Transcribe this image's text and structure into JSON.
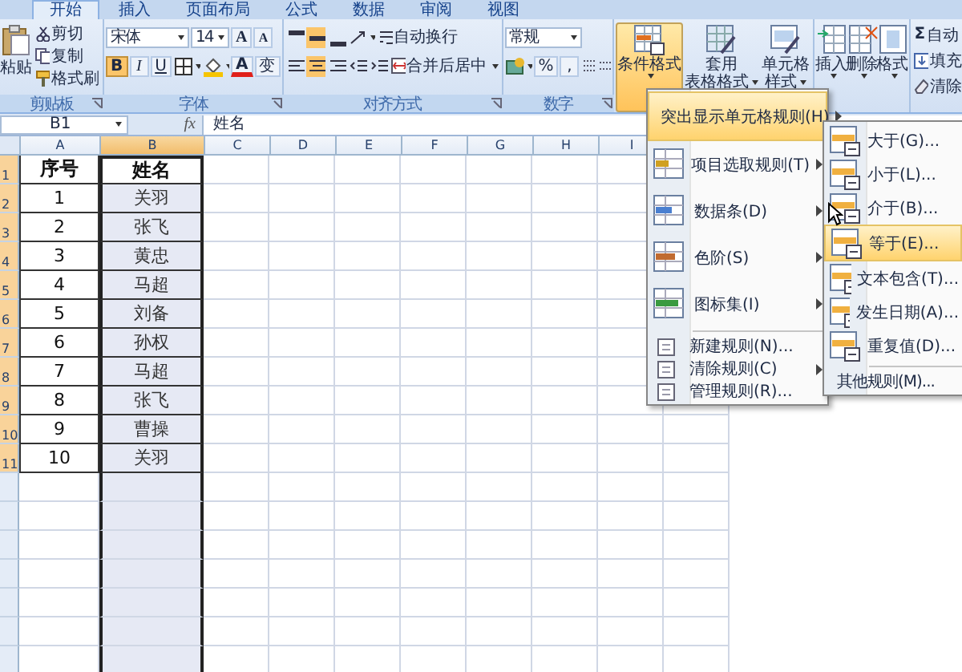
{
  "tabs": [
    {
      "label": "开始",
      "selected": true
    },
    {
      "label": "插入",
      "selected": false
    },
    {
      "label": "页面布局",
      "selected": false
    },
    {
      "label": "公式",
      "selected": false
    },
    {
      "label": "数据",
      "selected": false
    },
    {
      "label": "审阅",
      "selected": false
    },
    {
      "label": "视图",
      "selected": false
    }
  ],
  "ribbon": {
    "clipboard": {
      "label": "剪贴板",
      "paste": "粘贴",
      "cut": "剪切",
      "copy": "复制",
      "format_painter": "格式刷"
    },
    "font": {
      "label": "字体",
      "font_name": "宋体",
      "font_size": "14",
      "grow": "A",
      "shrink": "A",
      "toggles": [
        {
          "label": "B",
          "kind": "bold",
          "selected": true
        },
        {
          "label": "I",
          "kind": "italic",
          "selected": false
        },
        {
          "label": "U",
          "kind": "underline",
          "selected": false
        }
      ],
      "font_color": "A",
      "phonetic": "变"
    },
    "alignment": {
      "label": "对齐方式",
      "wrap_text": "自动换行",
      "merge": "合并后居中",
      "vertical": [
        {
          "selected": false
        },
        {
          "selected": true
        },
        {
          "selected": false
        }
      ],
      "horizontal": [
        {
          "selected": false
        },
        {
          "selected": true
        },
        {
          "selected": false
        }
      ]
    },
    "number": {
      "label": "数字",
      "format": "常规",
      "percent": "%",
      "comma": ","
    },
    "styles": {
      "conditional_format": {
        "label": "条件格式",
        "expanded": true
      },
      "table_format": [
        "套用",
        "表格格式"
      ],
      "cell_styles": [
        "单元格",
        "样式"
      ]
    },
    "cells": {
      "insert": "插入",
      "delete": "删除",
      "format": "格式"
    },
    "editing": {
      "sigma": "Σ",
      "autosum": "自动",
      "fill": "填充",
      "clear": "清除"
    }
  },
  "formula_bar": {
    "name_box": "B1",
    "function_label": "fx",
    "content": "姓名"
  },
  "columns": [
    {
      "label": "A",
      "selected": false
    },
    {
      "label": "B",
      "selected": true
    },
    {
      "label": "C",
      "selected": false
    },
    {
      "label": "D",
      "selected": false
    },
    {
      "label": "E",
      "selected": false
    },
    {
      "label": "F",
      "selected": false
    },
    {
      "label": "G",
      "selected": false
    },
    {
      "label": "H",
      "selected": false
    },
    {
      "label": "I",
      "selected": false
    }
  ],
  "rows": [
    {
      "number": "1",
      "selected": true,
      "kind": "header",
      "cells": [
        "序号",
        "姓名"
      ]
    },
    {
      "number": "2",
      "selected": true,
      "kind": "data",
      "cells": [
        "1",
        "关羽"
      ]
    },
    {
      "number": "3",
      "selected": true,
      "kind": "data",
      "cells": [
        "2",
        "张飞"
      ]
    },
    {
      "number": "4",
      "selected": true,
      "kind": "data",
      "cells": [
        "3",
        "黄忠"
      ]
    },
    {
      "number": "5",
      "selected": true,
      "kind": "data",
      "cells": [
        "4",
        "马超"
      ]
    },
    {
      "number": "6",
      "selected": true,
      "kind": "data",
      "cells": [
        "5",
        "刘备"
      ]
    },
    {
      "number": "7",
      "selected": true,
      "kind": "data",
      "cells": [
        "6",
        "孙权"
      ]
    },
    {
      "number": "8",
      "selected": true,
      "kind": "data",
      "cells": [
        "7",
        "马超"
      ]
    },
    {
      "number": "9",
      "selected": true,
      "kind": "data",
      "cells": [
        "8",
        "张飞"
      ]
    },
    {
      "number": "10",
      "selected": true,
      "kind": "data",
      "cells": [
        "9",
        "曹操"
      ]
    },
    {
      "number": "11",
      "selected": true,
      "kind": "data",
      "cells": [
        "10",
        "关羽"
      ]
    }
  ],
  "menu": {
    "items": [
      {
        "kind": "large",
        "label": "突出显示单元格规则(H)",
        "submenu": true,
        "selected": true
      },
      {
        "kind": "large",
        "label": "项目选取规则(T)",
        "submenu": true,
        "selected": false
      },
      {
        "kind": "large",
        "label": "数据条(D)",
        "submenu": true,
        "selected": false
      },
      {
        "kind": "large",
        "label": "色阶(S)",
        "submenu": true,
        "selected": false
      },
      {
        "kind": "large",
        "label": "图标集(I)",
        "submenu": true,
        "selected": false
      },
      {
        "kind": "small",
        "label": "新建规则(N)...",
        "submenu": false,
        "selected": false
      },
      {
        "kind": "small",
        "label": "清除规则(C)",
        "submenu": true,
        "selected": false
      },
      {
        "kind": "small",
        "label": "管理规则(R)...",
        "submenu": false,
        "selected": false
      }
    ]
  },
  "submenu": {
    "items": [
      {
        "kind": "large",
        "label": "大于(G)...",
        "selected": false
      },
      {
        "kind": "large",
        "label": "小于(L)...",
        "selected": false
      },
      {
        "kind": "large",
        "label": "介于(B)...",
        "selected": false
      },
      {
        "kind": "large",
        "label": "等于(E)...",
        "selected": true
      },
      {
        "kind": "large",
        "label": "文本包含(T)...",
        "selected": false
      },
      {
        "kind": "large",
        "label": "发生日期(A)...",
        "selected": false
      },
      {
        "kind": "large",
        "label": "重复值(D)...",
        "selected": false
      },
      {
        "kind": "small",
        "label": "其他规则(M)...",
        "selected": false
      }
    ]
  }
}
